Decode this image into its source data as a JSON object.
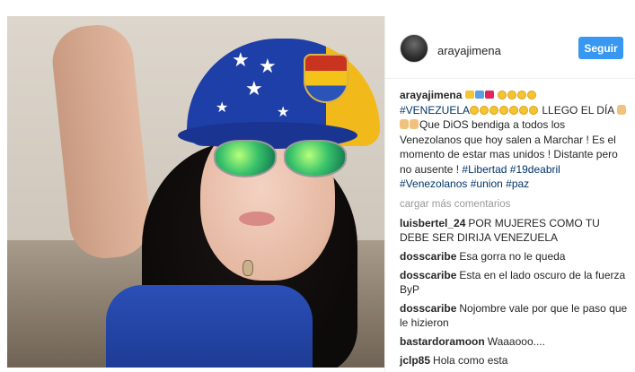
{
  "post": {
    "username": "arayajimena",
    "follow_label": "Seguir",
    "caption": {
      "author": "arayajimena",
      "hashtag_venezuela": "#VENEZUELA",
      "text1": " LLEGO EL DÍA ",
      "text2": "Que DiOS bendiga a todos los Venezolanos que hoy salen a Marchar ! Es el momento de estar mas unidos ! Distante pero no ausente ! ",
      "tags": [
        "#Libertad",
        "#19deabril",
        "#Venezolanos",
        "#union",
        "#paz"
      ]
    },
    "load_more_label": "cargar más comentarios",
    "comments": [
      {
        "author": "luisbertel_24",
        "text": "POR MUJERES COMO TU DEBE SER DIRIJA VENEZUELA"
      },
      {
        "author": "dosscaribe",
        "text": "Esa gorra no le queda"
      },
      {
        "author": "dosscaribe",
        "text": "Esta en el lado oscuro de la fuerza ByP"
      },
      {
        "author": "dosscaribe",
        "text": "Nojombre vale por que le paso que le hizieron"
      },
      {
        "author": "bastardoramoon",
        "text": "Waaaooo...."
      },
      {
        "author": "jclp85",
        "text": "Hola como esta"
      }
    ],
    "colors": {
      "follow_button": "#3897f0",
      "hashtag": "#003569",
      "muted": "#999999"
    },
    "icons": [
      "avatar-image",
      "heart-emoji",
      "face-emoji",
      "praying-hands-emoji"
    ]
  }
}
